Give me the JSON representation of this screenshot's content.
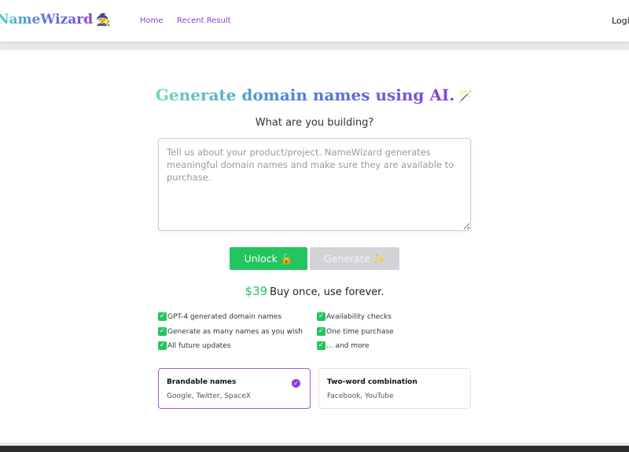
{
  "header": {
    "brand": "NameWizard",
    "brand_emoji": "🧙",
    "nav": [
      "Home",
      "Recent Result"
    ],
    "login": "Login"
  },
  "hero": {
    "headline": "Generate domain names using AI.",
    "headline_emoji": "🪄",
    "question": "What are you building?"
  },
  "input": {
    "placeholder": "Tell us about your product/project. NameWizard generates meaningful domain names and make sure they are available to purchase.",
    "value": ""
  },
  "buttons": {
    "unlock_label": "Unlock 🔓",
    "generate_label": "Generate ✨"
  },
  "pricing": {
    "price": "$39",
    "tagline": "Buy once, use forever."
  },
  "features": [
    "GPT-4 generated domain names",
    "Generate as many names as you wish",
    "All future updates",
    "Availability checks",
    "One time purchase",
    "... and more"
  ],
  "options": [
    {
      "title": "Brandable names",
      "subtitle": "Google, Twitter, SpaceX",
      "selected": true
    },
    {
      "title": "Two-word combination",
      "subtitle": "Facebook, YouTube",
      "selected": false
    }
  ],
  "colors": {
    "accent_green": "#22c55e",
    "accent_purple": "#8b3fd6"
  },
  "icons": {
    "feature_check": "check-icon",
    "option_selected": "check-circle-icon"
  }
}
